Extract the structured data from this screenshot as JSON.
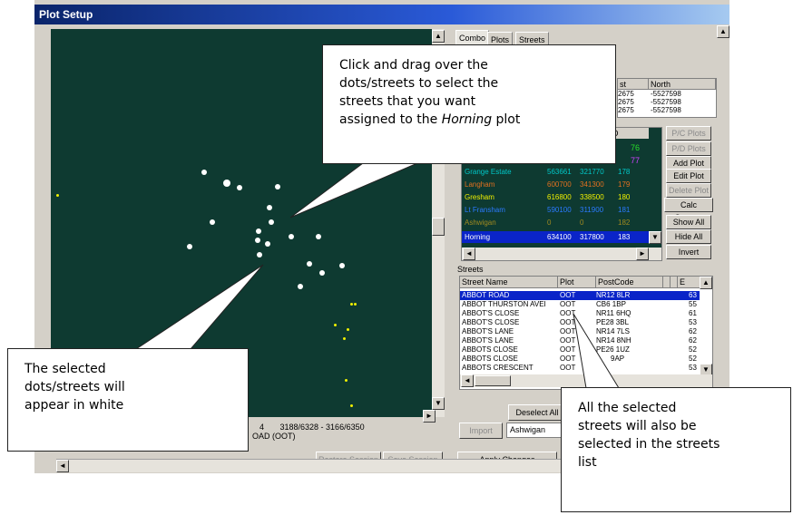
{
  "window": {
    "title": "Plot Setup"
  },
  "tabs": [
    "Combo",
    "Plots",
    "Streets"
  ],
  "top_table": {
    "headers": [
      "st",
      "North"
    ],
    "rows": [
      [
        "2675",
        "-5527598"
      ],
      [
        "2675",
        "-5527598"
      ],
      [
        "2675",
        "-5527598"
      ]
    ]
  },
  "plots_list": {
    "partial_header": "D",
    "top_partial": [
      "76",
      "77"
    ],
    "rows": [
      {
        "name": "Grange Estate",
        "east": "563661",
        "north": "321770",
        "num": "178",
        "color": "#00c8c8"
      },
      {
        "name": "Langham",
        "east": "600700",
        "north": "341300",
        "num": "179",
        "color": "#e07020"
      },
      {
        "name": "Gresham",
        "east": "616800",
        "north": "338500",
        "num": "180",
        "color": "#f0f000"
      },
      {
        "name": "Lt Fransham",
        "east": "590100",
        "north": "311900",
        "num": "181",
        "color": "#2a7aff"
      },
      {
        "name": "Ashwigan",
        "east": "0",
        "north": "0",
        "num": "182",
        "color": "#a08a20"
      },
      {
        "name": "Horning",
        "east": "634100",
        "north": "317800",
        "num": "183",
        "color": "#ffffff"
      }
    ]
  },
  "plot_buttons": {
    "pc_plots": "P/C Plots",
    "pd_plots": "P/D Plots",
    "add_plot": "Add Plot",
    "edit_plot": "Edit Plot",
    "delete_plot": "Delete Plot",
    "calc_centres": "Calc Centres",
    "show_all": "Show All",
    "hide_all": "Hide All",
    "invert": "Invert"
  },
  "streets": {
    "section_label": "Streets",
    "headers": [
      "Street Name",
      "Plot",
      "PostCode",
      "E"
    ],
    "rows": [
      {
        "name": "ABBOT ROAD",
        "plot": "OOT",
        "postcode": "NR12 8LR",
        "e": "63"
      },
      {
        "name": "ABBOT THURSTON AVEI",
        "plot": "OOT",
        "postcode": "CB6 1BP",
        "e": "55"
      },
      {
        "name": "ABBOT'S CLOSE",
        "plot": "OOT",
        "postcode": "NR11 6HQ",
        "e": "61"
      },
      {
        "name": "ABBOT'S CLOSE",
        "plot": "OOT",
        "postcode": "PE28 3BL",
        "e": "53"
      },
      {
        "name": "ABBOT'S LANE",
        "plot": "OOT",
        "postcode": "NR14 7LS",
        "e": "62"
      },
      {
        "name": "ABBOT'S LANE",
        "plot": "OOT",
        "postcode": "NR14 8NH",
        "e": "62"
      },
      {
        "name": "ABBOTS CLOSE",
        "plot": "OOT",
        "postcode": "PE26 1UZ",
        "e": "52"
      },
      {
        "name": "ABBOTS CLOSE",
        "plot": "OOT",
        "postcode": "9AP",
        "e": "52"
      },
      {
        "name": "ABBOTS CRESCENT",
        "plot": "OOT",
        "postcode": "",
        "e": "53"
      }
    ]
  },
  "bottom": {
    "deselect_all": "Deselect All",
    "import": "Import",
    "plot_select_value": "Ashwigan",
    "status_line1": "4       3188/6328 - 3166/6350",
    "status_line2": "OAD (OOT)",
    "restore_session": "Restore Session",
    "save_session": "Save Session",
    "apply_changes": "Apply Changes"
  },
  "callouts": {
    "top": "Click and drag over the dots/streets to select the streets that you want assigned to the Horning plot",
    "top_parts": [
      "Click and drag over the",
      "dots/streets to select the",
      "streets that you want",
      "assigned to the ",
      "Horning",
      " plot"
    ],
    "left": [
      "The selected",
      "dots/streets will",
      "appear in white"
    ],
    "right": [
      "All the selected",
      "streets will also be",
      "selected in the streets",
      "list"
    ]
  },
  "colors": {
    "titlebar": "#0a246a",
    "plot_bg": "#0e3a31",
    "selection": "#0a24c8",
    "white_dot": "#ffffff",
    "yellow_dot": "#f0f000"
  }
}
